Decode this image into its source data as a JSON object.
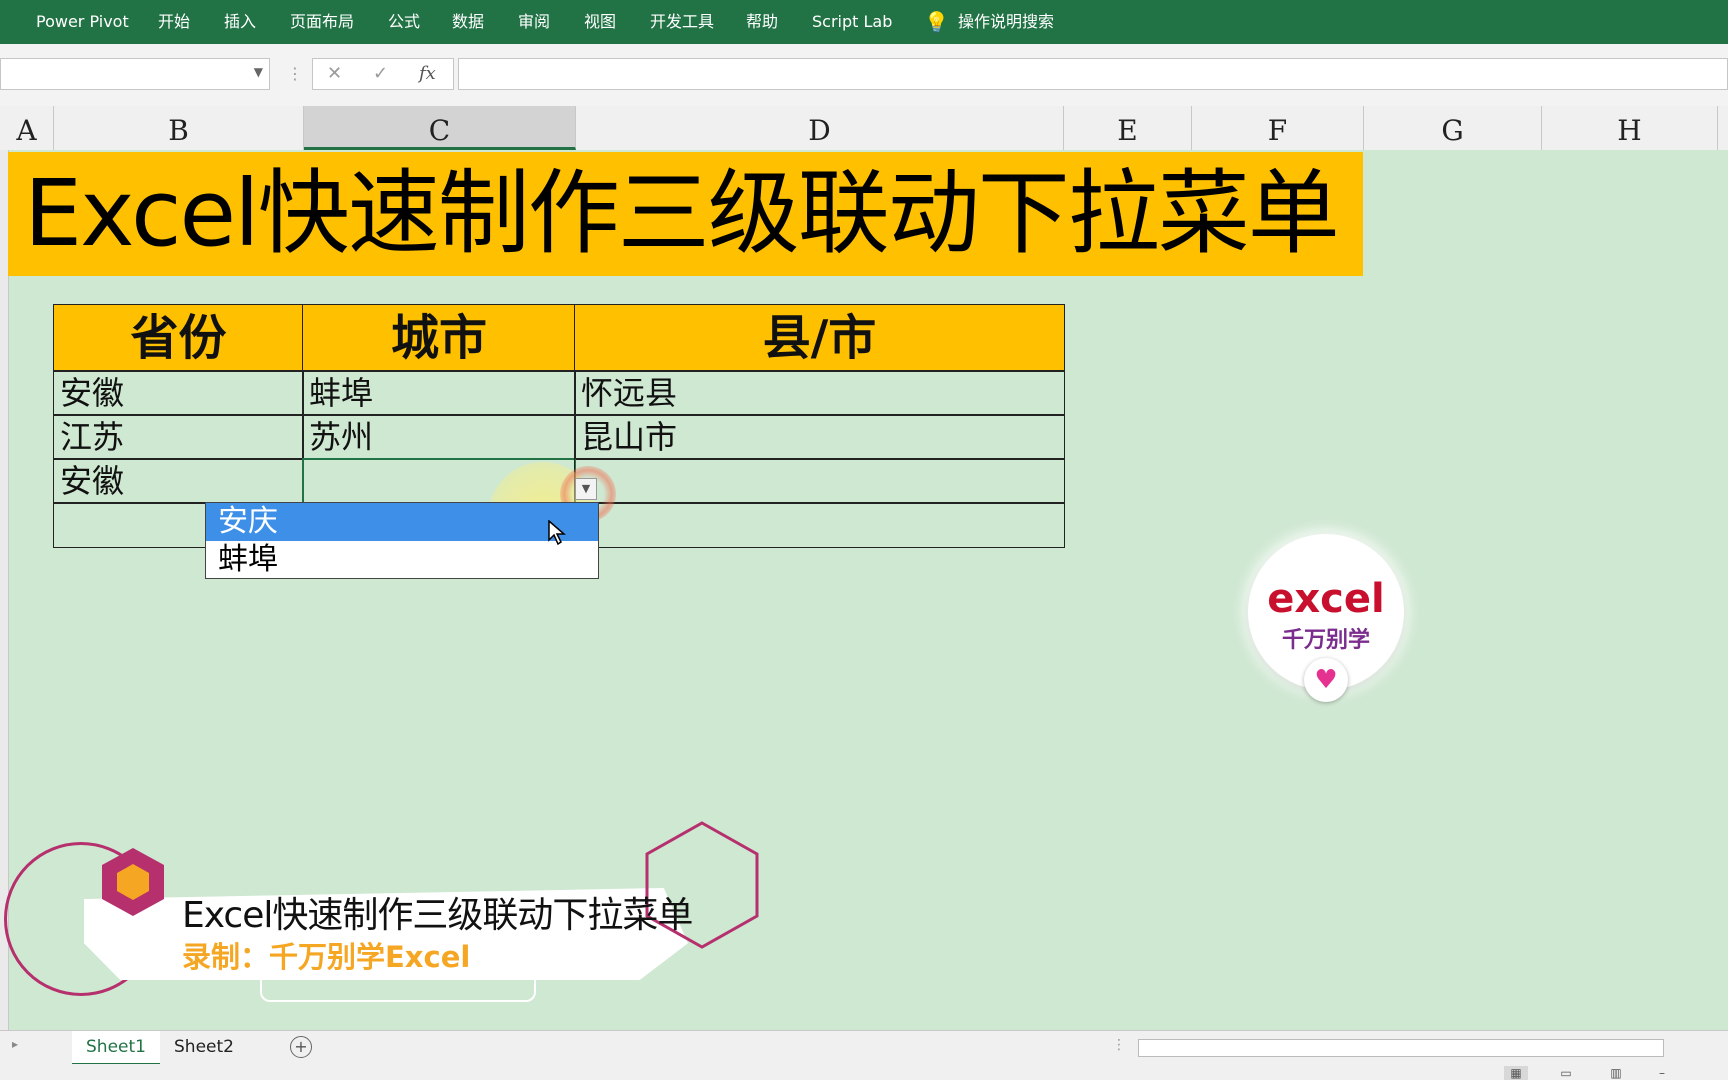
{
  "ribbon": {
    "tabs": [
      "Power Pivot",
      "开始",
      "插入",
      "页面布局",
      "公式",
      "数据",
      "审阅",
      "视图",
      "开发工具",
      "帮助",
      "Script Lab"
    ],
    "tell_me": "操作说明搜索"
  },
  "formula_bar": {
    "cancel": "✕",
    "enter": "✓",
    "fx": "fx"
  },
  "columns": [
    "A",
    "B",
    "C",
    "D",
    "E",
    "F",
    "G",
    "H"
  ],
  "sheet_title": "Excel快速制作三级联动下拉菜单",
  "table": {
    "headers": [
      "省份",
      "城市",
      "县/市"
    ],
    "rows": [
      [
        "安徽",
        "蚌埠",
        "怀远县"
      ],
      [
        "江苏",
        "苏州",
        "昆山市"
      ],
      [
        "安徽",
        "",
        ""
      ],
      [
        "",
        "",
        ""
      ]
    ]
  },
  "dropdown": {
    "options": [
      "安庆",
      "蚌埠"
    ],
    "highlighted": "安庆"
  },
  "logo": {
    "line1": "excel",
    "line2": "千万别学"
  },
  "caption": {
    "title": "Excel快速制作三级联动下拉菜单",
    "subtitle": "录制：千万别学Excel"
  },
  "sheets": [
    "Sheet1",
    "Sheet2"
  ],
  "colors": {
    "ribbon": "#217346",
    "header_fill": "#ffc000",
    "sheet_bg": "#cfe8d2",
    "dropdown_highlight": "#3d8fe8"
  }
}
